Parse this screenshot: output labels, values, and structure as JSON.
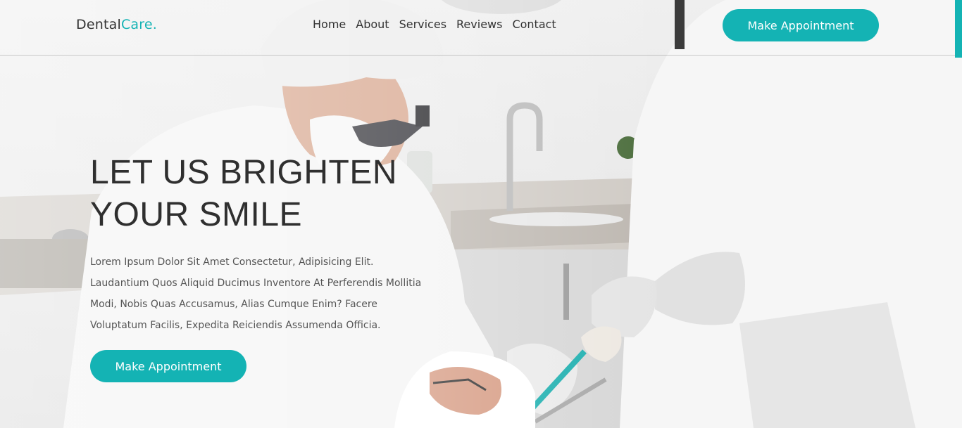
{
  "brand": {
    "name": "Dental",
    "accent": "Care."
  },
  "nav": {
    "items": [
      {
        "label": "Home"
      },
      {
        "label": "About"
      },
      {
        "label": "Services"
      },
      {
        "label": "Reviews"
      },
      {
        "label": "Contact"
      }
    ]
  },
  "header": {
    "cta_label": "Make Appointment"
  },
  "hero": {
    "title_line1": "LET US BRIGHTEN",
    "title_line2": "YOUR SMILE",
    "text_lines": [
      "Lorem Ipsum Dolor Sit Amet Consectetur, Adipisicing Elit.",
      "Laudantium Quos Aliquid Ducimus Inventore At Perferendis Mollitia",
      "Modi, Nobis Quas Accusamus, Alias Cumque Enim? Facere",
      "Voluptatum Facilis, Expedita Reiciendis Assumenda Officia."
    ],
    "cta_label": "Make Appointment"
  },
  "colors": {
    "accent": "#14b3b4",
    "text_dark": "#2f2f2f",
    "text_body": "#555555"
  }
}
